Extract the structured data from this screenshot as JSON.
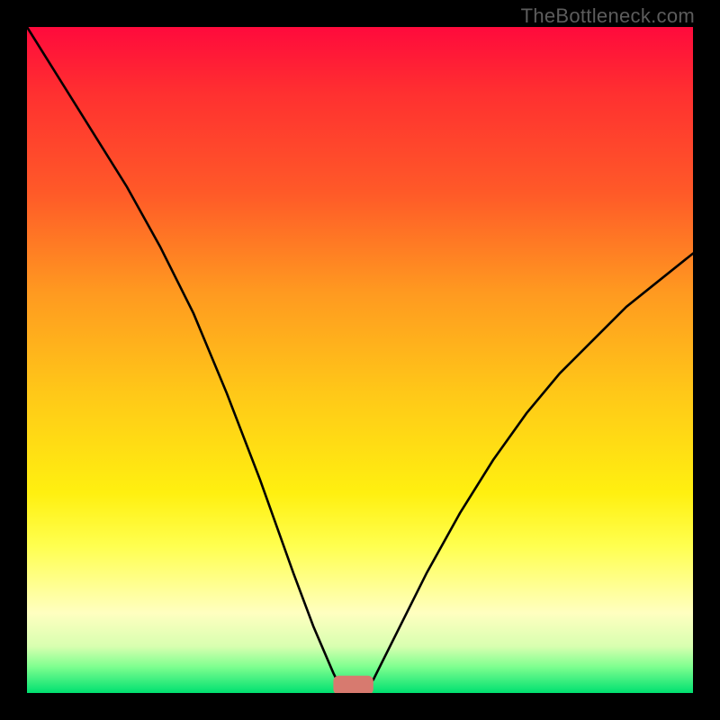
{
  "watermark": "TheBottleneck.com",
  "chart_data": {
    "type": "line",
    "title": "",
    "xlabel": "",
    "ylabel": "",
    "xlim": [
      0,
      100
    ],
    "ylim": [
      0,
      100
    ],
    "grid": false,
    "legend": false,
    "background_gradient": {
      "stops": [
        {
          "pos": 0.0,
          "color": "#ff0a3c"
        },
        {
          "pos": 0.1,
          "color": "#ff3030"
        },
        {
          "pos": 0.25,
          "color": "#ff5a28"
        },
        {
          "pos": 0.4,
          "color": "#ff9a20"
        },
        {
          "pos": 0.55,
          "color": "#ffc818"
        },
        {
          "pos": 0.7,
          "color": "#fff010"
        },
        {
          "pos": 0.78,
          "color": "#ffff50"
        },
        {
          "pos": 0.88,
          "color": "#ffffc0"
        },
        {
          "pos": 0.93,
          "color": "#d8ffb0"
        },
        {
          "pos": 0.96,
          "color": "#80ff90"
        },
        {
          "pos": 1.0,
          "color": "#00e070"
        }
      ]
    },
    "series": [
      {
        "name": "bottleneck-curve",
        "color": "#000000",
        "x": [
          0,
          5,
          10,
          15,
          20,
          25,
          30,
          35,
          40,
          43,
          46,
          47,
          48,
          50,
          52,
          55,
          60,
          65,
          70,
          75,
          80,
          85,
          90,
          95,
          100
        ],
        "y": [
          100,
          92,
          84,
          76,
          67,
          57,
          45,
          32,
          18,
          10,
          3,
          1,
          0,
          0,
          2,
          8,
          18,
          27,
          35,
          42,
          48,
          53,
          58,
          62,
          66
        ]
      }
    ],
    "marker": {
      "name": "optimum-point",
      "shape": "rounded-rect",
      "color": "#d77a6f",
      "x": 49,
      "y": 0,
      "width": 6,
      "height": 2
    }
  }
}
